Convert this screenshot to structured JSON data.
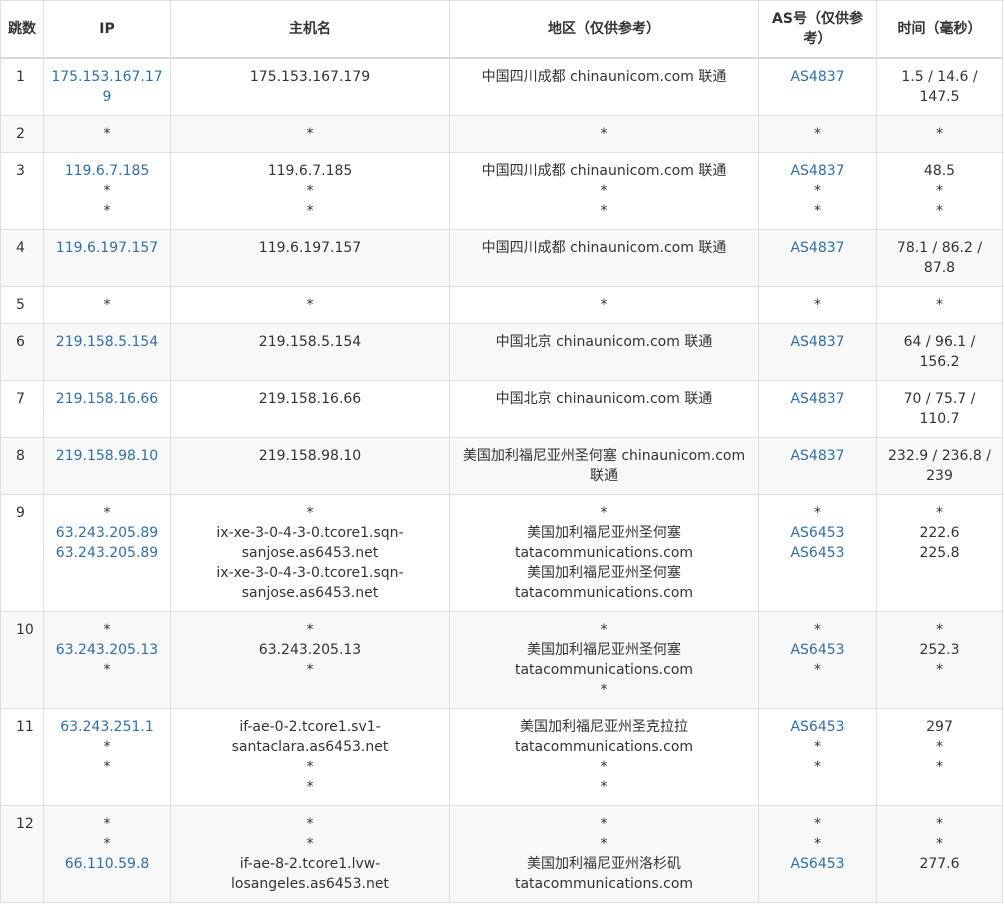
{
  "headers": {
    "hop": "跳数",
    "ip": "IP",
    "host": "主机名",
    "region": "地区（仅供参考）",
    "as": "AS号（仅供参考）",
    "time": "时间（毫秒）"
  },
  "rows": [
    {
      "hop": "1",
      "ip": [
        "175.153.167.179"
      ],
      "host": [
        "175.153.167.179"
      ],
      "region": [
        "中国四川成都 chinaunicom.com 联通"
      ],
      "as": [
        "AS4837"
      ],
      "time": [
        "1.5 / 14.6 /",
        "147.5"
      ]
    },
    {
      "hop": "2",
      "ip": [
        "*"
      ],
      "host": [
        "*"
      ],
      "region": [
        "*"
      ],
      "as": [
        "*"
      ],
      "time": [
        "*"
      ]
    },
    {
      "hop": "3",
      "ip": [
        "119.6.7.185",
        "*",
        "*"
      ],
      "host": [
        "119.6.7.185",
        "*",
        "*"
      ],
      "region": [
        "中国四川成都 chinaunicom.com 联通",
        "*",
        "*"
      ],
      "as": [
        "AS4837",
        "*",
        "*"
      ],
      "time": [
        "48.5",
        "*",
        "*"
      ]
    },
    {
      "hop": "4",
      "ip": [
        "119.6.197.157"
      ],
      "host": [
        "119.6.197.157"
      ],
      "region": [
        "中国四川成都 chinaunicom.com 联通"
      ],
      "as": [
        "AS4837"
      ],
      "time": [
        "78.1 / 86.2 /",
        "87.8"
      ]
    },
    {
      "hop": "5",
      "ip": [
        "*"
      ],
      "host": [
        "*"
      ],
      "region": [
        "*"
      ],
      "as": [
        "*"
      ],
      "time": [
        "*"
      ]
    },
    {
      "hop": "6",
      "ip": [
        "219.158.5.154"
      ],
      "host": [
        "219.158.5.154"
      ],
      "region": [
        "中国北京 chinaunicom.com 联通"
      ],
      "as": [
        "AS4837"
      ],
      "time": [
        "64 / 96.1 /",
        "156.2"
      ]
    },
    {
      "hop": "7",
      "ip": [
        "219.158.16.66"
      ],
      "host": [
        "219.158.16.66"
      ],
      "region": [
        "中国北京 chinaunicom.com 联通"
      ],
      "as": [
        "AS4837"
      ],
      "time": [
        "70 / 75.7 /",
        "110.7"
      ]
    },
    {
      "hop": "8",
      "ip": [
        "219.158.98.10"
      ],
      "host": [
        "219.158.98.10"
      ],
      "region": [
        "美国加利福尼亚州圣何塞 chinaunicom.com",
        "联通"
      ],
      "as": [
        "AS4837"
      ],
      "time": [
        "232.9 / 236.8 /",
        "239"
      ]
    },
    {
      "hop": "9",
      "ip": [
        "*",
        "63.243.205.89",
        "63.243.205.89"
      ],
      "host": [
        "*",
        "ix-xe-3-0-4-3-0.tcore1.sqn-",
        "sanjose.as6453.net",
        "ix-xe-3-0-4-3-0.tcore1.sqn-",
        "sanjose.as6453.net"
      ],
      "region": [
        "*",
        "美国加利福尼亚州圣何塞",
        "tatacommunications.com",
        "美国加利福尼亚州圣何塞",
        "tatacommunications.com"
      ],
      "as": [
        "*",
        "AS6453",
        "AS6453"
      ],
      "time": [
        "*",
        "222.6",
        "225.8"
      ]
    },
    {
      "hop": "10",
      "ip": [
        "*",
        "63.243.205.13",
        "*"
      ],
      "host": [
        "*",
        "63.243.205.13",
        "*"
      ],
      "region": [
        "*",
        "美国加利福尼亚州圣何塞",
        "tatacommunications.com",
        "*"
      ],
      "as": [
        "*",
        "AS6453",
        "*"
      ],
      "time": [
        "*",
        "252.3",
        "*"
      ]
    },
    {
      "hop": "11",
      "ip": [
        "63.243.251.1",
        "*",
        "*"
      ],
      "host": [
        "if-ae-0-2.tcore1.sv1-",
        "santaclara.as6453.net",
        "*",
        "*"
      ],
      "region": [
        "美国加利福尼亚州圣克拉拉",
        "tatacommunications.com",
        "*",
        "*"
      ],
      "as": [
        "AS6453",
        "*",
        "*"
      ],
      "time": [
        "297",
        "*",
        "*"
      ]
    },
    {
      "hop": "12",
      "ip": [
        "*",
        "*",
        "66.110.59.8"
      ],
      "host": [
        "*",
        "*",
        "if-ae-8-2.tcore1.lvw-",
        "losangeles.as6453.net"
      ],
      "region": [
        "*",
        "*",
        "美国加利福尼亚州洛杉矶",
        "tatacommunications.com"
      ],
      "as": [
        "*",
        "*",
        "AS6453"
      ],
      "time": [
        "*",
        "*",
        "277.6"
      ]
    }
  ],
  "colors": {
    "link": "#2f6fa7",
    "border": "#dfdfdf",
    "stripe": "#f8f8f8"
  }
}
